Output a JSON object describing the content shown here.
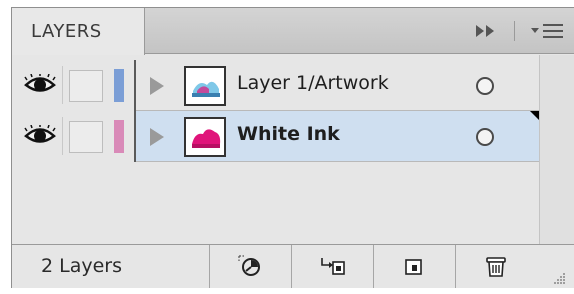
{
  "panel": {
    "tab_label": "LAYERS"
  },
  "layers": [
    {
      "name": "Layer 1/Artwork",
      "color": "#7b9ed6",
      "selected": false,
      "thumb": "artwork-thumbnail"
    },
    {
      "name": "White Ink",
      "color": "#d98ab8",
      "selected": true,
      "thumb": "white-ink-thumbnail"
    }
  ],
  "footer": {
    "layer_count": "2 Layers",
    "buttons": [
      "locate-object-icon",
      "make-clipping-mask-icon",
      "new-sublayer-icon",
      "trash-icon"
    ]
  },
  "colors": {
    "panel_bg": "#e6e6e6",
    "selected_row": "#cfdff0",
    "layer1": "#7b9ed6",
    "white_ink": "#d98ab8",
    "magenta": "#e0147a"
  }
}
